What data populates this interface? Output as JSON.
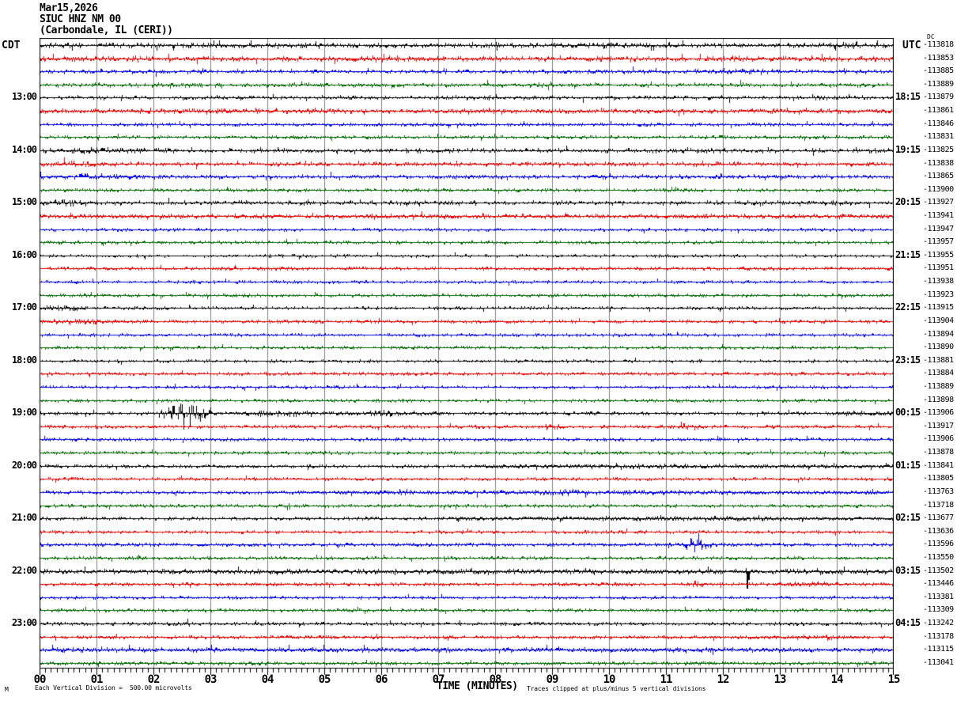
{
  "header": {
    "date": "Mar15,2026",
    "station": "SIUC HNZ NM 00",
    "location": "(Carbondale, IL (CERI))"
  },
  "axes": {
    "left_label": "CDT",
    "right_label": "UTC",
    "dc_label": "DC",
    "left_hours": [
      "13:00",
      "14:00",
      "15:00",
      "16:00",
      "17:00",
      "18:00",
      "19:00",
      "20:00",
      "21:00",
      "22:00",
      "23:00"
    ],
    "right_hours": [
      "18:15",
      "19:15",
      "20:15",
      "21:15",
      "22:15",
      "23:15",
      "00:15",
      "01:15",
      "02:15",
      "03:15",
      "04:15"
    ],
    "hour_row_start": 4,
    "hour_row_step": 4,
    "x_ticks": [
      "00",
      "01",
      "02",
      "03",
      "04",
      "05",
      "06",
      "07",
      "08",
      "09",
      "10",
      "11",
      "12",
      "13",
      "14",
      "15"
    ],
    "x_title": "TIME (MINUTES)"
  },
  "right_values": [
    "-113818",
    "-113853",
    "-113885",
    "-113889",
    "-113879",
    "-113861",
    "-113846",
    "-113831",
    "-113825",
    "-113838",
    "-113865",
    "-113900",
    "-113927",
    "-113941",
    "-113947",
    "-113957",
    "-113955",
    "-113951",
    "-113938",
    "-113923",
    "-113915",
    "-113904",
    "-113894",
    "-113890",
    "-113881",
    "-113884",
    "-113889",
    "-113898",
    "-113906",
    "-113917",
    "-113906",
    "-113878",
    "-113841",
    "-113805",
    "-113763",
    "-113718",
    "-113677",
    "-113636",
    "-113596",
    "-113550",
    "-113502",
    "-113446",
    "-113381",
    "-113309",
    "-113242",
    "-113178",
    "-113115",
    "-113041"
  ],
  "footer": {
    "corner_glyph": "M",
    "scale_note": "Each Vertical Division =  500.00 microvolts",
    "clip_note": "Traces clipped at plus/minus 5 vertical divisions"
  },
  "colors": {
    "trace_cycle": [
      "#000000",
      "#e60000",
      "#0000e6",
      "#006400"
    ],
    "grid": "#808080",
    "frame": "#000000",
    "background": "#ffffff"
  },
  "chart_data": {
    "type": "line",
    "title": "SIUC HNZ NM 00 helicorder, Mar15,2026, Carbondale IL (CERI)",
    "x_range_minutes": [
      0,
      15
    ],
    "minutes_per_row": 15,
    "row_color_order": "black,red,blue,green repeating; each CDT hour starts black",
    "rows": [
      {
        "start_cdt": "12:00",
        "noise_amp": 1.5,
        "noise_density": 0.7,
        "bursts": [
          [
            4.6,
            5.2,
            2.5
          ],
          [
            9.3,
            10.3,
            2.0
          ],
          [
            13.9,
            14.6,
            2.5
          ]
        ],
        "spikes": []
      },
      {
        "start_cdt": "12:15",
        "noise_amp": 1.5,
        "noise_density": 0.75,
        "bursts": [
          [
            5.4,
            6.6,
            2.2
          ]
        ],
        "spikes": []
      },
      {
        "start_cdt": "12:30",
        "noise_amp": 1.2,
        "noise_density": 0.6,
        "bursts": [
          [
            11.8,
            13.2,
            2.0
          ]
        ],
        "spikes": []
      },
      {
        "start_cdt": "12:45",
        "noise_amp": 1.2,
        "noise_density": 0.6,
        "bursts": [
          [
            5.5,
            5.8,
            2.0
          ]
        ],
        "spikes": []
      },
      {
        "start_cdt": "13:00",
        "noise_amp": 1.2,
        "noise_density": 0.55,
        "bursts": [],
        "spikes": []
      },
      {
        "start_cdt": "13:15",
        "noise_amp": 1.3,
        "noise_density": 0.8,
        "bursts": [],
        "spikes": []
      },
      {
        "start_cdt": "13:30",
        "noise_amp": 1.1,
        "noise_density": 0.5,
        "bursts": [],
        "spikes": []
      },
      {
        "start_cdt": "13:45",
        "noise_amp": 1.1,
        "noise_density": 0.5,
        "bursts": [],
        "spikes": []
      },
      {
        "start_cdt": "14:00",
        "noise_amp": 1.3,
        "noise_density": 0.6,
        "bursts": [
          [
            0,
            1.8,
            2.0
          ]
        ],
        "spikes": []
      },
      {
        "start_cdt": "14:15",
        "noise_amp": 1.2,
        "noise_density": 0.6,
        "bursts": [
          [
            0,
            1.2,
            2.0
          ]
        ],
        "spikes": []
      },
      {
        "start_cdt": "14:30",
        "noise_amp": 1.2,
        "noise_density": 0.6,
        "bursts": [
          [
            0,
            1.8,
            2.0
          ]
        ],
        "spikes": []
      },
      {
        "start_cdt": "14:45",
        "noise_amp": 1.1,
        "noise_density": 0.5,
        "bursts": [],
        "spikes": []
      },
      {
        "start_cdt": "15:00",
        "noise_amp": 1.3,
        "noise_density": 0.6,
        "bursts": [
          [
            0,
            0.9,
            2.5
          ]
        ],
        "spikes": []
      },
      {
        "start_cdt": "15:15",
        "noise_amp": 1.2,
        "noise_density": 0.8,
        "bursts": [],
        "spikes": []
      },
      {
        "start_cdt": "15:30",
        "noise_amp": 1.0,
        "noise_density": 0.4,
        "bursts": [],
        "spikes": []
      },
      {
        "start_cdt": "15:45",
        "noise_amp": 1.0,
        "noise_density": 0.45,
        "bursts": [],
        "spikes": []
      },
      {
        "start_cdt": "16:00",
        "noise_amp": 0.9,
        "noise_density": 0.35,
        "bursts": [],
        "spikes": []
      },
      {
        "start_cdt": "16:15",
        "noise_amp": 0.9,
        "noise_density": 0.5,
        "bursts": [],
        "spikes": []
      },
      {
        "start_cdt": "16:30",
        "noise_amp": 0.9,
        "noise_density": 0.4,
        "bursts": [],
        "spikes": []
      },
      {
        "start_cdt": "16:45",
        "noise_amp": 1.0,
        "noise_density": 0.45,
        "bursts": [],
        "spikes": []
      },
      {
        "start_cdt": "17:00",
        "noise_amp": 0.9,
        "noise_density": 0.4,
        "bursts": [
          [
            0,
            0.8,
            1.8
          ]
        ],
        "spikes": []
      },
      {
        "start_cdt": "17:15",
        "noise_amp": 1.0,
        "noise_density": 0.5,
        "bursts": [
          [
            0,
            1.4,
            2.0
          ]
        ],
        "spikes": []
      },
      {
        "start_cdt": "17:30",
        "noise_amp": 0.9,
        "noise_density": 0.4,
        "bursts": [],
        "spikes": []
      },
      {
        "start_cdt": "17:45",
        "noise_amp": 0.9,
        "noise_density": 0.45,
        "bursts": [],
        "spikes": []
      },
      {
        "start_cdt": "18:00",
        "noise_amp": 0.9,
        "noise_density": 0.4,
        "bursts": [],
        "spikes": [
          [
            8.15,
            2.5
          ]
        ]
      },
      {
        "start_cdt": "18:15",
        "noise_amp": 1.0,
        "noise_density": 0.5,
        "bursts": [],
        "spikes": []
      },
      {
        "start_cdt": "18:30",
        "noise_amp": 0.9,
        "noise_density": 0.4,
        "bursts": [],
        "spikes": []
      },
      {
        "start_cdt": "18:45",
        "noise_amp": 0.9,
        "noise_density": 0.45,
        "bursts": [],
        "spikes": []
      },
      {
        "start_cdt": "19:00",
        "noise_amp": 1.0,
        "noise_density": 0.5,
        "bursts": [
          [
            2.05,
            3.1,
            7.0
          ],
          [
            3.3,
            4.9,
            2.2
          ],
          [
            5.2,
            7.1,
            1.8
          ],
          [
            13.9,
            15,
            1.6
          ]
        ],
        "spikes": [
          [
            2.35,
            9
          ],
          [
            2.3,
            -5
          ]
        ]
      },
      {
        "start_cdt": "19:15",
        "noise_amp": 1.0,
        "noise_density": 0.5,
        "bursts": [
          [
            8.8,
            9.2,
            2.5
          ],
          [
            11.2,
            11.6,
            2.5
          ]
        ],
        "spikes": []
      },
      {
        "start_cdt": "19:30",
        "noise_amp": 1.0,
        "noise_density": 0.5,
        "bursts": [],
        "spikes": []
      },
      {
        "start_cdt": "19:45",
        "noise_amp": 0.9,
        "noise_density": 0.45,
        "bursts": [],
        "spikes": []
      },
      {
        "start_cdt": "20:00",
        "noise_amp": 1.0,
        "noise_density": 0.5,
        "bursts": [
          [
            7.5,
            15,
            1.3
          ]
        ],
        "spikes": []
      },
      {
        "start_cdt": "20:15",
        "noise_amp": 0.9,
        "noise_density": 0.45,
        "bursts": [],
        "spikes": []
      },
      {
        "start_cdt": "20:30",
        "noise_amp": 1.1,
        "noise_density": 0.55,
        "bursts": [
          [
            4.8,
            15,
            1.4
          ],
          [
            6.3,
            6.6,
            2.0
          ],
          [
            9.0,
            9.5,
            2.5
          ]
        ],
        "spikes": []
      },
      {
        "start_cdt": "20:45",
        "noise_amp": 0.9,
        "noise_density": 0.5,
        "bursts": [],
        "spikes": [
          [
            4.35,
            -5
          ],
          [
            4.38,
            3
          ]
        ]
      },
      {
        "start_cdt": "21:00",
        "noise_amp": 1.0,
        "noise_density": 0.5,
        "bursts": [
          [
            7.3,
            15,
            1.4
          ]
        ],
        "spikes": []
      },
      {
        "start_cdt": "21:15",
        "noise_amp": 0.9,
        "noise_density": 0.45,
        "bursts": [],
        "spikes": []
      },
      {
        "start_cdt": "21:30",
        "noise_amp": 1.1,
        "noise_density": 0.6,
        "bursts": [
          [
            11.3,
            11.8,
            5.0
          ]
        ],
        "spikes": [
          [
            11.45,
            7
          ],
          [
            11.5,
            -7
          ]
        ]
      },
      {
        "start_cdt": "21:45",
        "noise_amp": 0.9,
        "noise_density": 0.5,
        "bursts": [],
        "spikes": []
      },
      {
        "start_cdt": "22:00",
        "noise_amp": 1.4,
        "noise_density": 0.9,
        "bursts": [],
        "spikes": [
          [
            12.4,
            4
          ],
          [
            12.42,
            -21
          ],
          [
            12.45,
            -10
          ]
        ]
      },
      {
        "start_cdt": "22:15",
        "noise_amp": 1.0,
        "noise_density": 0.55,
        "bursts": [
          [
            11.4,
            11.7,
            2.0
          ],
          [
            12.9,
            14.2,
            1.5
          ]
        ],
        "spikes": []
      },
      {
        "start_cdt": "22:30",
        "noise_amp": 0.9,
        "noise_density": 0.45,
        "bursts": [],
        "spikes": []
      },
      {
        "start_cdt": "22:45",
        "noise_amp": 0.9,
        "noise_density": 0.5,
        "bursts": [],
        "spikes": []
      },
      {
        "start_cdt": "23:00",
        "noise_amp": 1.0,
        "noise_density": 0.5,
        "bursts": [],
        "spikes": [
          [
            2.6,
            6
          ],
          [
            2.63,
            -3
          ]
        ]
      },
      {
        "start_cdt": "23:15",
        "noise_amp": 1.0,
        "noise_density": 0.55,
        "bursts": [
          [
            12.5,
            14.5,
            1.5
          ]
        ],
        "spikes": []
      },
      {
        "start_cdt": "23:30",
        "noise_amp": 1.3,
        "noise_density": 0.85,
        "bursts": [],
        "spikes": []
      },
      {
        "start_cdt": "23:45",
        "noise_amp": 1.0,
        "noise_density": 0.6,
        "bursts": [],
        "spikes": []
      }
    ]
  }
}
